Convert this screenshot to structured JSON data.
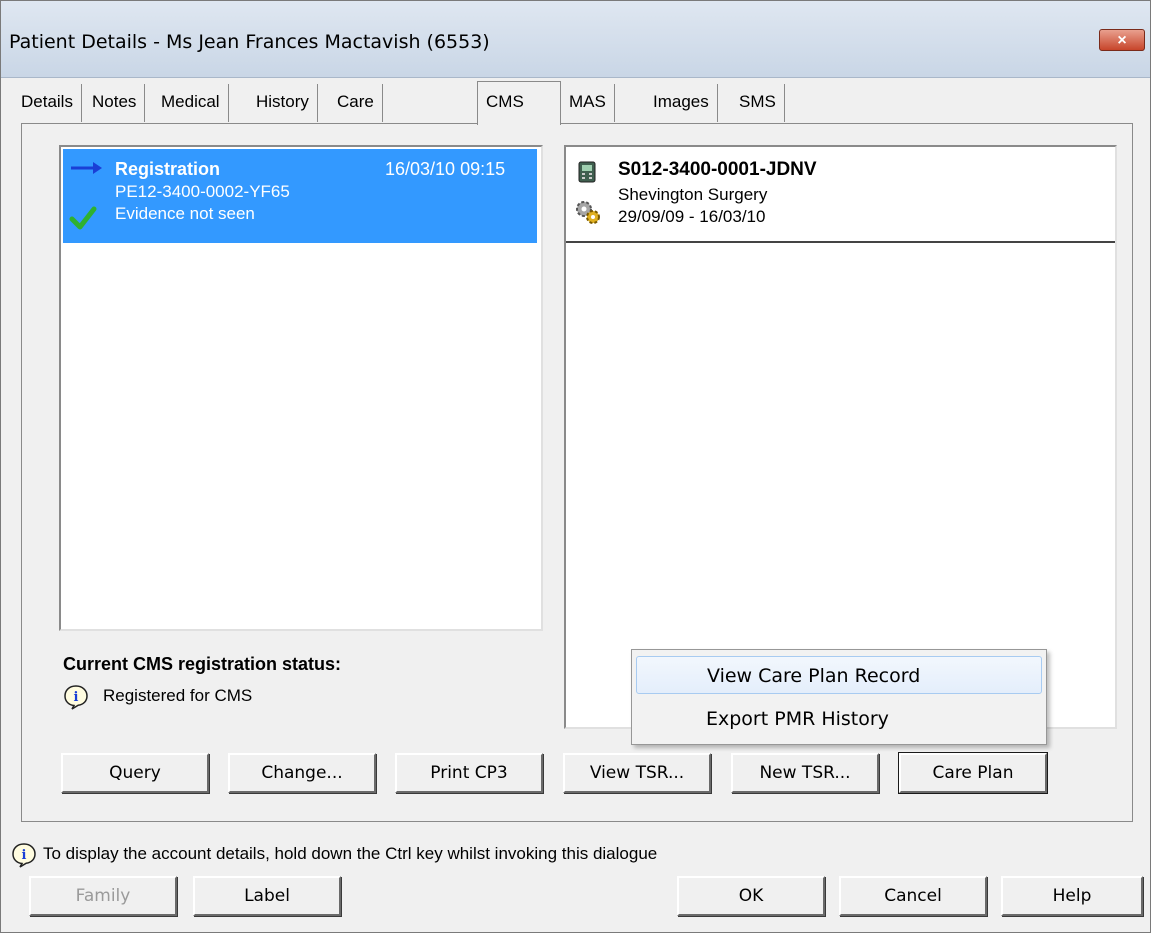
{
  "window": {
    "title": "Patient Details - Ms Jean Frances Mactavish (6553)",
    "close_label": "×"
  },
  "tabs": [
    {
      "label": "Details"
    },
    {
      "label": "Notes"
    },
    {
      "label": "Medical"
    },
    {
      "label": "History"
    },
    {
      "label": "Care"
    },
    {
      "label": "CMS",
      "active": true
    },
    {
      "label": "MAS"
    },
    {
      "label": "Images"
    },
    {
      "label": "SMS"
    }
  ],
  "registration": {
    "title": "Registration",
    "date": "16/03/10 09:15",
    "code": "PE12-3400-0002-YF65",
    "evidence": "Evidence not seen",
    "icons": [
      "arrow-right-icon",
      "check-icon"
    ]
  },
  "tsr": {
    "code": "S012-3400-0001-JDNV",
    "surgery": "Shevington Surgery",
    "dates": "29/09/09 - 16/03/10",
    "icons": [
      "device-icon",
      "gear-icon"
    ]
  },
  "status": {
    "heading": "Current CMS registration status:",
    "value": "Registered for CMS"
  },
  "buttons": {
    "query": "Query",
    "change": "Change...",
    "print_cp3": "Print CP3",
    "view_tsr": "View TSR...",
    "new_tsr": "New TSR...",
    "care_plan": "Care Plan"
  },
  "context_menu": {
    "items": [
      "View Care Plan Record",
      "Export PMR History"
    ]
  },
  "footer": {
    "hint": "To display the account details, hold down the Ctrl key whilst invoking this dialogue",
    "family": "Family",
    "label": "Label",
    "ok": "OK",
    "cancel": "Cancel",
    "help": "Help"
  },
  "colors": {
    "selection": "#3399ff",
    "arrow": "#1a3fd6",
    "check": "#2fb12f"
  }
}
